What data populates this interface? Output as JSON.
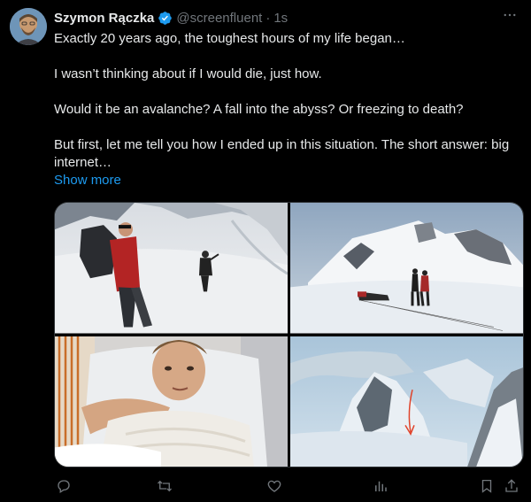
{
  "author": {
    "name": "Szymon Rączka",
    "handle": "@screenfluent",
    "separator": "·",
    "time": "1s",
    "verified": true,
    "avatar_icon": "avatar-photo"
  },
  "tweet": {
    "paragraphs": [
      "Exactly 20 years ago, the toughest hours of my life began…",
      "I wasn’t thinking about if I would die, just how.",
      "Would it be an avalanche? A fall into the abyss? Or freezing to death?",
      "But first, let me tell you how I ended up in this situation. The short answer: big internet…"
    ],
    "show_more": "Show more"
  },
  "media": [
    {
      "icon": "photo-climbers-on-glacier"
    },
    {
      "icon": "photo-mountain-with-rescuers"
    },
    {
      "icon": "photo-man-in-hospital-bed"
    },
    {
      "icon": "photo-mountain-face-with-arrow"
    }
  ],
  "actions": [
    {
      "name": "reply-icon"
    },
    {
      "name": "retweet-icon"
    },
    {
      "name": "like-icon"
    },
    {
      "name": "views-icon"
    },
    {
      "name": "bookmark-icon"
    },
    {
      "name": "share-icon"
    }
  ],
  "colors": {
    "background": "#000000",
    "text": "#e7e9ea",
    "secondary": "#71767b",
    "accent": "#1d9bf0",
    "border": "#2f3336"
  }
}
